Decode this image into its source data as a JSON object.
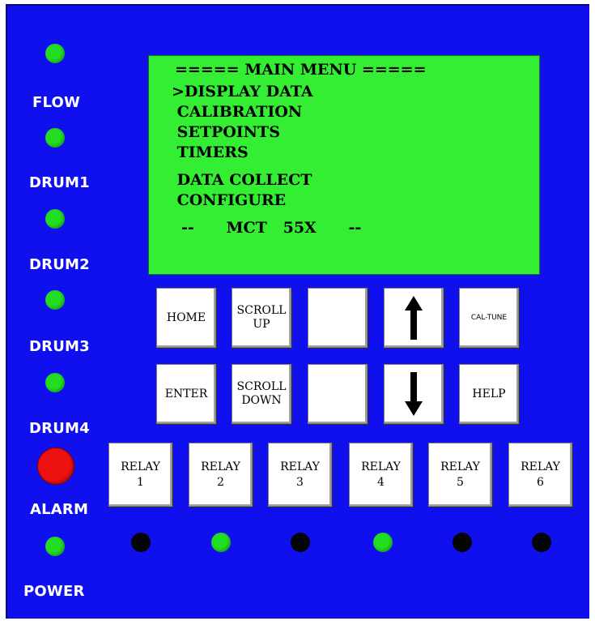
{
  "leds": {
    "flow": {
      "label": "FLOW",
      "state": "on"
    },
    "drum1": {
      "label": "DRUM1",
      "state": "on"
    },
    "drum2": {
      "label": "DRUM2",
      "state": "on"
    },
    "drum3": {
      "label": "DRUM3",
      "state": "on"
    },
    "drum4": {
      "label": "DRUM4",
      "state": "on"
    },
    "alarm": {
      "label": "ALARM",
      "state": "on",
      "color": "#ee1111"
    },
    "power": {
      "label": "POWER",
      "state": "on"
    }
  },
  "lcd": {
    "title": "===== MAIN MENU =====",
    "items": [
      ">DISPLAY DATA",
      " CALIBRATION",
      " SETPOINTS",
      " TIMERS",
      " DATA COLLECT",
      " CONFIGURE"
    ],
    "footer": "--      MCT   55X      --"
  },
  "keys": {
    "home": "HOME",
    "scroll_up_1": "SCROLL",
    "scroll_up_2": "UP",
    "blank1": "",
    "up_arrow": "up-arrow-icon",
    "cal_tune": "CAL-TUNE",
    "enter": "ENTER",
    "scroll_down_1": "SCROLL",
    "scroll_down_2": "DOWN",
    "blank2": "",
    "down_arrow": "down-arrow-icon",
    "help": "HELP"
  },
  "relays": [
    {
      "label": "RELAY",
      "num": "1",
      "indicator": "off"
    },
    {
      "label": "RELAY",
      "num": "2",
      "indicator": "on"
    },
    {
      "label": "RELAY",
      "num": "3",
      "indicator": "off"
    },
    {
      "label": "RELAY",
      "num": "4",
      "indicator": "on"
    },
    {
      "label": "RELAY",
      "num": "5",
      "indicator": "off"
    },
    {
      "label": "RELAY",
      "num": "6",
      "indicator": "off"
    }
  ],
  "colors": {
    "panel": "#1010ee",
    "lcd": "#33ee33",
    "led_on": "#22dd22",
    "led_off": "#050505",
    "alarm": "#ee1111"
  }
}
